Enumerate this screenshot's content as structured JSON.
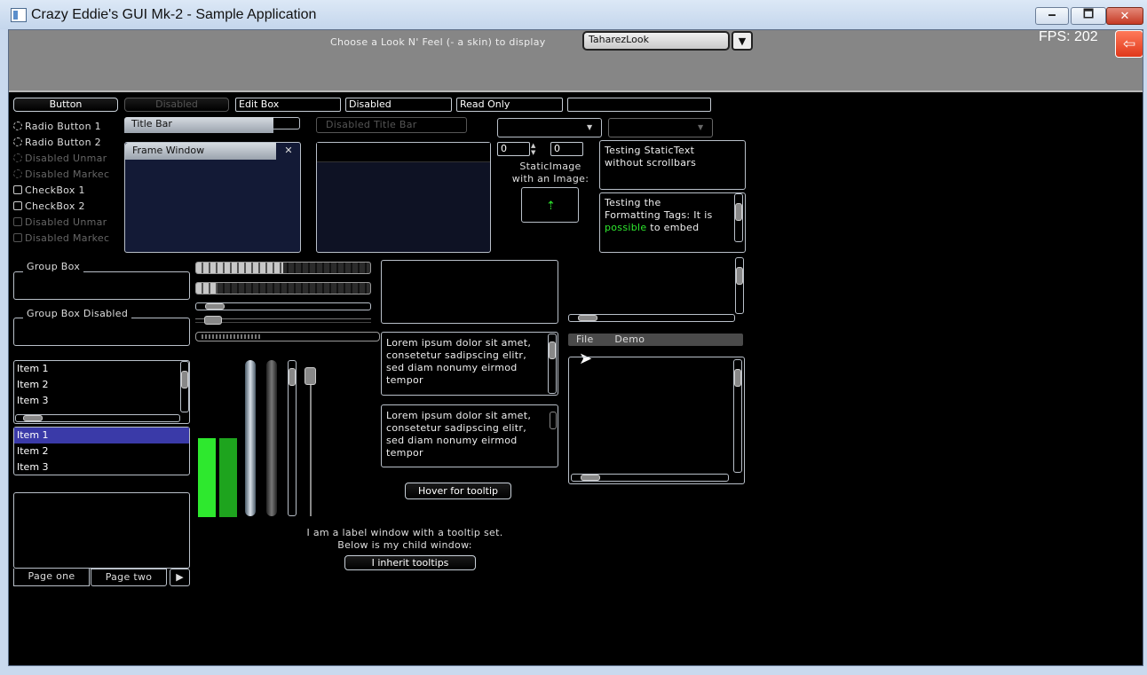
{
  "window": {
    "title": "Crazy Eddie's GUI Mk-2 - Sample Application",
    "minimize": "🗕",
    "maximize": "🗖",
    "close": "✕"
  },
  "topbar": {
    "skin_label": "Choose a Look N' Feel (- a skin) to display",
    "skin_value": "TaharezLook",
    "dropdown_glyph": "▼",
    "fps": "FPS: 202",
    "exit_glyph": "⇦"
  },
  "buttons": {
    "button": "Button",
    "disabled": "Disabled",
    "edit_box": "Edit Box",
    "edit_disabled": "Disabled",
    "read_only": "Read Only",
    "hover_tooltip": "Hover for tooltip",
    "inherit_tooltips": "I inherit tooltips"
  },
  "radios": [
    "Radio Button 1",
    "Radio Button 2",
    "Disabled Unmar",
    "Disabled Markec"
  ],
  "checks": [
    "CheckBox 1",
    "CheckBox 2",
    "Disabled Unmar",
    "Disabled Markec"
  ],
  "titlebar": {
    "title": "Title Bar",
    "disabled": "Disabled Title Bar"
  },
  "frame_window": {
    "title": "Frame Window",
    "close_glyph": "✕"
  },
  "spinners": {
    "value1": "0",
    "value2": "0"
  },
  "static_image": {
    "label_line1": "StaticImage",
    "label_line2": "with an Image:"
  },
  "static_text": {
    "plain_line1": "Testing StaticText",
    "plain_line2": "without scrollbars",
    "formatted_line1": "Testing the",
    "formatted_line2": "Formatting Tags: It is",
    "formatted_green": "possible",
    "formatted_rest": " to embed"
  },
  "groups": {
    "group_box": "Group Box",
    "group_disabled": "Group Box Disabled"
  },
  "progress": {
    "bar1": 0.5,
    "bar2": 0.12
  },
  "sliders": {
    "h1": 0.05,
    "h2": 0.05
  },
  "lorem": "Lorem ipsum dolor sit amet, consetetur sadipscing elitr, sed diam nonumy eirmod tempor",
  "menu": {
    "file": "File",
    "demo": "Demo"
  },
  "listbox1": [
    "Item 1",
    "Item 2",
    "Item 3"
  ],
  "listbox2": [
    "Item 1",
    "Item 2",
    "Item 3"
  ],
  "tabs": {
    "page_one": "Page one",
    "page_two": "Page two",
    "next_glyph": "▶"
  },
  "label_window": {
    "line1": "I am a label window with a tooltip set.",
    "line2": "Below is my child window:"
  },
  "colors": {
    "green": "#2ee82e",
    "selection": "#3a3aa8",
    "dark_panel": "#131a36"
  }
}
